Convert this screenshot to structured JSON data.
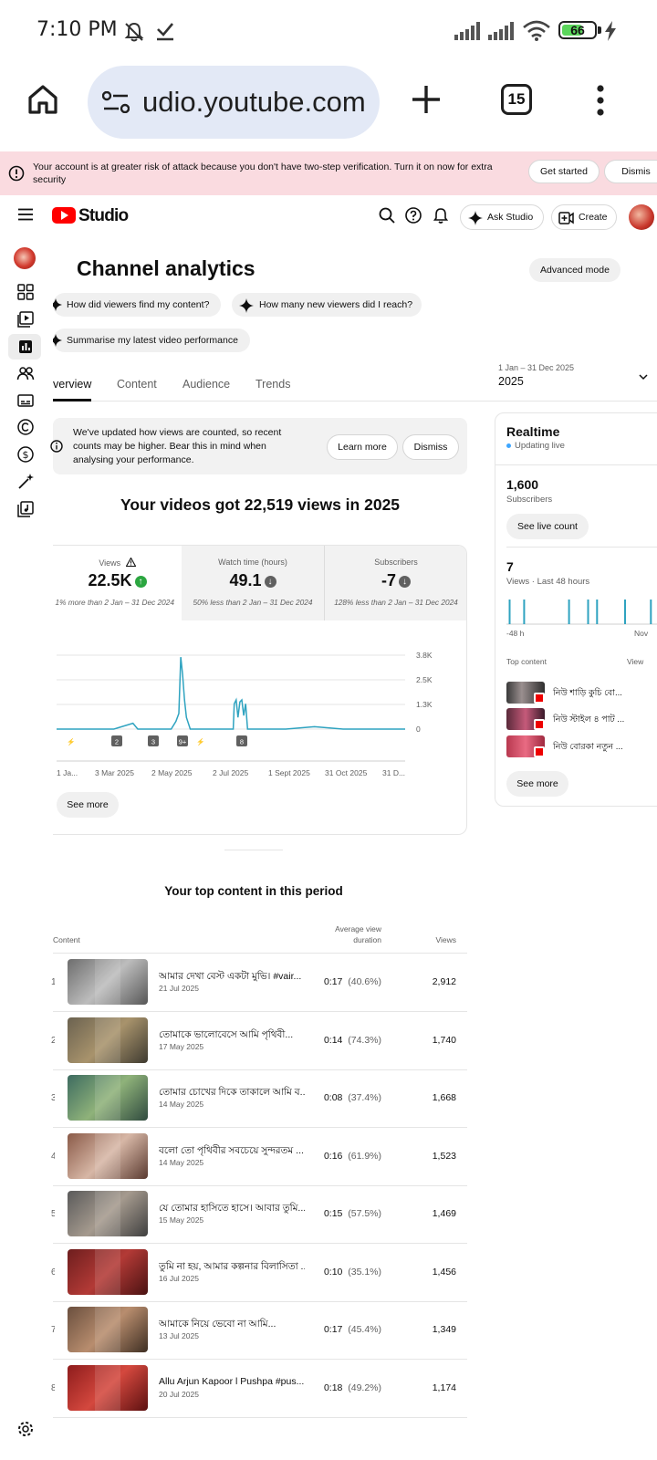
{
  "status_bar": {
    "time": "7:10 PM",
    "battery": "66",
    "battery_level": 0.66
  },
  "browser": {
    "url": "udio.youtube.com",
    "tab_count": "15"
  },
  "security_banner": {
    "text": "Your account is at greater risk of attack because you don't have two-step verification. Turn it on now for extra security",
    "get_started": "Get started",
    "dismiss": "Dismis"
  },
  "header": {
    "logo_text": "Studio",
    "ask_studio": "Ask Studio",
    "create": "Create"
  },
  "page": {
    "title": "Channel analytics",
    "advanced_mode": "Advanced mode",
    "chips": [
      "How did viewers find my content?",
      "How many new viewers did I reach?",
      "Summarise my latest video performance"
    ],
    "tabs": [
      "verview",
      "Content",
      "Audience",
      "Trends"
    ],
    "date_range_small": "1 Jan – 31 Dec 2025",
    "date_range": "2025"
  },
  "notice": {
    "text": "We've updated how views are counted, so recent counts may be higher. Bear this in mind when analysing your performance.",
    "learn_more": "Learn more",
    "dismiss": "Dismiss"
  },
  "headline": "Your videos got 22,519 views in 2025",
  "kpis": [
    {
      "label": "Views",
      "value": "22.5K",
      "sub": "1% more than 2 Jan – 31 Dec 2024",
      "trend": "up"
    },
    {
      "label": "Watch time (hours)",
      "value": "49.1",
      "sub": "50% less than 2 Jan – 31 Dec 2024",
      "trend": "down"
    },
    {
      "label": "Subscribers",
      "value": "-7",
      "sub": "128% less than 2 Jan – 31 Dec 2024",
      "trend": "down"
    }
  ],
  "chart_data": {
    "type": "line",
    "x_labels": [
      "1 Ja...",
      "3 Mar 2025",
      "2 May 2025",
      "2 Jul 2025",
      "1 Sept 2025",
      "31 Oct 2025",
      "31 D..."
    ],
    "y_ticks": [
      "3.8K",
      "2.5K",
      "1.3K",
      "0"
    ],
    "ylim": [
      0,
      3800
    ],
    "series": [
      {
        "values": [
          [
            0,
            0
          ],
          [
            30,
            0
          ],
          [
            60,
            0
          ],
          [
            80,
            300
          ],
          [
            85,
            0
          ],
          [
            100,
            0
          ],
          [
            120,
            0
          ],
          [
            125,
            400
          ],
          [
            128,
            800
          ],
          [
            130,
            3700
          ],
          [
            132,
            2800
          ],
          [
            134,
            1500
          ],
          [
            136,
            600
          ],
          [
            140,
            0
          ],
          [
            160,
            0
          ],
          [
            185,
            0
          ],
          [
            186,
            1300
          ],
          [
            188,
            1500
          ],
          [
            190,
            600
          ],
          [
            192,
            1400
          ],
          [
            194,
            1500
          ],
          [
            196,
            700
          ],
          [
            198,
            1300
          ],
          [
            200,
            0
          ],
          [
            240,
            0
          ],
          [
            270,
            120
          ],
          [
            300,
            0
          ],
          [
            330,
            0
          ],
          [
            365,
            0
          ]
        ]
      }
    ],
    "color": "#2fa3c0",
    "markers": [
      "",
      "2",
      "3",
      "9+",
      "",
      "8"
    ],
    "grid": true
  },
  "see_more": "See more",
  "realtime": {
    "title": "Realtime",
    "live": "Updating live",
    "subscribers_value": "1,600",
    "subscribers_label": "Subscribers",
    "see_live": "See live count",
    "views_value": "7",
    "views_label": "Views · Last 48 hours",
    "axis_left": "-48 h",
    "axis_right": "Nov",
    "bars": [
      0.2,
      1.5,
      5.5,
      7.2,
      8.0,
      10.5,
      12.8,
      14.0
    ],
    "top_content_label": "Top content",
    "view_label": "View",
    "top_content": [
      "নিউ শাড়ি কুচি বো...",
      "নিউ স্টাইল ৪ পাট ...",
      "নিউ বোরকা নতুন ..."
    ],
    "see_more": "See more"
  },
  "top_content": {
    "title": "Your top content in this period",
    "col_content": "Content",
    "col_avg_line1": "Average view",
    "col_avg_line2": "duration",
    "col_views": "Views",
    "rows": [
      {
        "rank": "1",
        "title": "আমার দেখা বেস্ট একটা মুভি। #vair...",
        "date": "21 Jul 2025",
        "duration": "0:17",
        "pct": "(40.6%)",
        "views": "2,912"
      },
      {
        "rank": "2",
        "title": "তোমাকে ভালোবেসে আমি পৃথিবী...",
        "date": "17 May 2025",
        "duration": "0:14",
        "pct": "(74.3%)",
        "views": "1,740"
      },
      {
        "rank": "3",
        "title": "তোমার চোখের দিকে তাকালে আমি ব...",
        "date": "14 May 2025",
        "duration": "0:08",
        "pct": "(37.4%)",
        "views": "1,668"
      },
      {
        "rank": "4",
        "title": "বলো তো পৃথিবীর সবচেয়ে সুন্দরতম ...",
        "date": "14 May 2025",
        "duration": "0:16",
        "pct": "(61.9%)",
        "views": "1,523"
      },
      {
        "rank": "5",
        "title": "যে তোমার হাসিতে হাসে। আবার তুমি...",
        "date": "15 May 2025",
        "duration": "0:15",
        "pct": "(57.5%)",
        "views": "1,469"
      },
      {
        "rank": "6",
        "title": "তুমি না হয়, আমার কল্পনার বিলাসিতা ...",
        "date": "16 Jul 2025",
        "duration": "0:10",
        "pct": "(35.1%)",
        "views": "1,456"
      },
      {
        "rank": "7",
        "title": "আমাকে নিয়ে ভেবো না আমি...",
        "date": "13 Jul 2025",
        "duration": "0:17",
        "pct": "(45.4%)",
        "views": "1,349"
      },
      {
        "rank": "8",
        "title": "Allu Arjun Kapoor l Pushpa #pus...",
        "date": "20 Jul 2025",
        "duration": "0:18",
        "pct": "(49.2%)",
        "views": "1,174"
      }
    ]
  }
}
